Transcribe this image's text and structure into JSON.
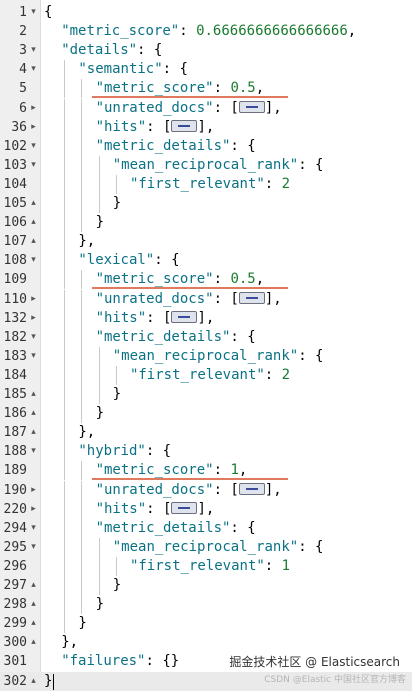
{
  "editor": {
    "lines": [
      {
        "n": "1",
        "fold": "▾",
        "depth": 0,
        "parts": [
          [
            "p",
            "{"
          ]
        ]
      },
      {
        "n": "2",
        "fold": "",
        "depth": 1,
        "parts": [
          [
            "k",
            "\"metric_score\""
          ],
          [
            "p",
            ": "
          ],
          [
            "n",
            "0.6666666666666666"
          ],
          [
            "p",
            ","
          ]
        ]
      },
      {
        "n": "3",
        "fold": "▾",
        "depth": 1,
        "parts": [
          [
            "k",
            "\"details\""
          ],
          [
            "p",
            ": {"
          ]
        ]
      },
      {
        "n": "4",
        "fold": "▾",
        "depth": 2,
        "parts": [
          [
            "k",
            "\"semantic\""
          ],
          [
            "p",
            ": {"
          ]
        ]
      },
      {
        "n": "5",
        "fold": "",
        "depth": 3,
        "parts": [
          [
            "k",
            "\"metric_score\""
          ],
          [
            "p",
            ": "
          ],
          [
            "n",
            "0.5"
          ],
          [
            "p",
            ","
          ]
        ]
      },
      {
        "n": "6",
        "fold": "▸",
        "depth": 3,
        "parts": [
          [
            "k",
            "\"unrated_docs\""
          ],
          [
            "p",
            ": ["
          ],
          [
            "fold",
            ""
          ],
          [
            "p",
            "],"
          ]
        ]
      },
      {
        "n": "36",
        "fold": "▸",
        "depth": 3,
        "parts": [
          [
            "k",
            "\"hits\""
          ],
          [
            "p",
            ": ["
          ],
          [
            "fold",
            ""
          ],
          [
            "p",
            "],"
          ]
        ]
      },
      {
        "n": "102",
        "fold": "▾",
        "depth": 3,
        "parts": [
          [
            "k",
            "\"metric_details\""
          ],
          [
            "p",
            ": {"
          ]
        ]
      },
      {
        "n": "103",
        "fold": "▾",
        "depth": 4,
        "parts": [
          [
            "k",
            "\"mean_reciprocal_rank\""
          ],
          [
            "p",
            ": {"
          ]
        ]
      },
      {
        "n": "104",
        "fold": "",
        "depth": 5,
        "parts": [
          [
            "k",
            "\"first_relevant\""
          ],
          [
            "p",
            ": "
          ],
          [
            "n",
            "2"
          ]
        ]
      },
      {
        "n": "105",
        "fold": "▴",
        "depth": 4,
        "parts": [
          [
            "p",
            "}"
          ]
        ]
      },
      {
        "n": "106",
        "fold": "▴",
        "depth": 3,
        "parts": [
          [
            "p",
            "}"
          ]
        ]
      },
      {
        "n": "107",
        "fold": "▴",
        "depth": 2,
        "parts": [
          [
            "p",
            "},"
          ]
        ]
      },
      {
        "n": "108",
        "fold": "▾",
        "depth": 2,
        "parts": [
          [
            "k",
            "\"lexical\""
          ],
          [
            "p",
            ": {"
          ]
        ]
      },
      {
        "n": "109",
        "fold": "",
        "depth": 3,
        "parts": [
          [
            "k",
            "\"metric_score\""
          ],
          [
            "p",
            ": "
          ],
          [
            "n",
            "0.5"
          ],
          [
            "p",
            ","
          ]
        ]
      },
      {
        "n": "110",
        "fold": "▸",
        "depth": 3,
        "parts": [
          [
            "k",
            "\"unrated_docs\""
          ],
          [
            "p",
            ": ["
          ],
          [
            "fold",
            ""
          ],
          [
            "p",
            "],"
          ]
        ]
      },
      {
        "n": "132",
        "fold": "▸",
        "depth": 3,
        "parts": [
          [
            "k",
            "\"hits\""
          ],
          [
            "p",
            ": ["
          ],
          [
            "fold",
            ""
          ],
          [
            "p",
            "],"
          ]
        ]
      },
      {
        "n": "182",
        "fold": "▾",
        "depth": 3,
        "parts": [
          [
            "k",
            "\"metric_details\""
          ],
          [
            "p",
            ": {"
          ]
        ]
      },
      {
        "n": "183",
        "fold": "▾",
        "depth": 4,
        "parts": [
          [
            "k",
            "\"mean_reciprocal_rank\""
          ],
          [
            "p",
            ": {"
          ]
        ]
      },
      {
        "n": "184",
        "fold": "",
        "depth": 5,
        "parts": [
          [
            "k",
            "\"first_relevant\""
          ],
          [
            "p",
            ": "
          ],
          [
            "n",
            "2"
          ]
        ]
      },
      {
        "n": "185",
        "fold": "▴",
        "depth": 4,
        "parts": [
          [
            "p",
            "}"
          ]
        ]
      },
      {
        "n": "186",
        "fold": "▴",
        "depth": 3,
        "parts": [
          [
            "p",
            "}"
          ]
        ]
      },
      {
        "n": "187",
        "fold": "▴",
        "depth": 2,
        "parts": [
          [
            "p",
            "},"
          ]
        ]
      },
      {
        "n": "188",
        "fold": "▾",
        "depth": 2,
        "parts": [
          [
            "k",
            "\"hybrid\""
          ],
          [
            "p",
            ": {"
          ]
        ]
      },
      {
        "n": "189",
        "fold": "",
        "depth": 3,
        "parts": [
          [
            "k",
            "\"metric_score\""
          ],
          [
            "p",
            ": "
          ],
          [
            "n",
            "1"
          ],
          [
            "p",
            ","
          ]
        ]
      },
      {
        "n": "190",
        "fold": "▸",
        "depth": 3,
        "parts": [
          [
            "k",
            "\"unrated_docs\""
          ],
          [
            "p",
            ": ["
          ],
          [
            "fold",
            ""
          ],
          [
            "p",
            "],"
          ]
        ]
      },
      {
        "n": "220",
        "fold": "▸",
        "depth": 3,
        "parts": [
          [
            "k",
            "\"hits\""
          ],
          [
            "p",
            ": ["
          ],
          [
            "fold",
            ""
          ],
          [
            "p",
            "],"
          ]
        ]
      },
      {
        "n": "294",
        "fold": "▾",
        "depth": 3,
        "parts": [
          [
            "k",
            "\"metric_details\""
          ],
          [
            "p",
            ": {"
          ]
        ]
      },
      {
        "n": "295",
        "fold": "▾",
        "depth": 4,
        "parts": [
          [
            "k",
            "\"mean_reciprocal_rank\""
          ],
          [
            "p",
            ": {"
          ]
        ]
      },
      {
        "n": "296",
        "fold": "",
        "depth": 5,
        "parts": [
          [
            "k",
            "\"first_relevant\""
          ],
          [
            "p",
            ": "
          ],
          [
            "n",
            "1"
          ]
        ]
      },
      {
        "n": "297",
        "fold": "▴",
        "depth": 4,
        "parts": [
          [
            "p",
            "}"
          ]
        ]
      },
      {
        "n": "298",
        "fold": "▴",
        "depth": 3,
        "parts": [
          [
            "p",
            "}"
          ]
        ]
      },
      {
        "n": "299",
        "fold": "▴",
        "depth": 2,
        "parts": [
          [
            "p",
            "}"
          ]
        ]
      },
      {
        "n": "300",
        "fold": "▴",
        "depth": 1,
        "parts": [
          [
            "p",
            "},"
          ]
        ]
      },
      {
        "n": "301",
        "fold": "",
        "depth": 1,
        "parts": [
          [
            "k",
            "\"failures\""
          ],
          [
            "p",
            ": {}"
          ]
        ]
      },
      {
        "n": "302",
        "fold": "▴",
        "depth": 0,
        "parts": [
          [
            "p",
            "}"
          ]
        ]
      }
    ],
    "active_line": "302",
    "highlighted_lines": [
      "5",
      "109",
      "189"
    ]
  },
  "colors": {
    "key": "#0b7285",
    "number": "#1a7b2f",
    "underline": "#e07a5f",
    "gutter": "#efefef"
  },
  "watermark": {
    "main": "掘金技术社区 @ Elasticsearch",
    "sub": "CSDN @Elastic 中国社区官方博客"
  }
}
